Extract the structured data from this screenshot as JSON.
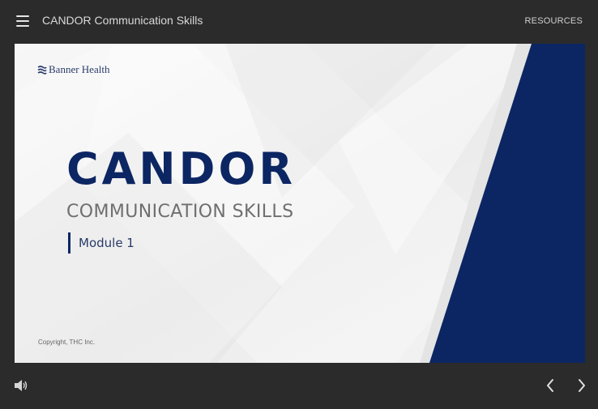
{
  "header": {
    "menu_icon": "hamburger-menu-icon",
    "course_title": "CANDOR Communication Skills",
    "resources_label": "RESOURCES"
  },
  "slide": {
    "logo_text": "Banner Health",
    "logo_icon": "banner-health-logo-icon",
    "title": "CANDOR",
    "subtitle": "COMMUNICATION SKILLS",
    "module_label": "Module 1",
    "copyright": "Copyright, THC Inc.",
    "colors": {
      "navy": "#0c2663",
      "background": "#f2f2f2",
      "chrome": "#2b2b2b"
    }
  },
  "footer": {
    "audio_icon": "speaker-icon",
    "prev_icon": "chevron-left-icon",
    "next_icon": "chevron-right-icon"
  }
}
